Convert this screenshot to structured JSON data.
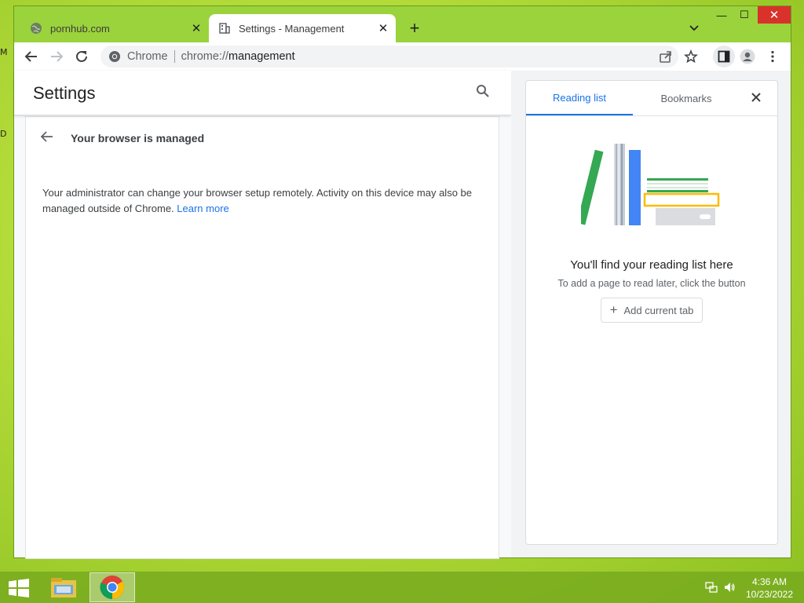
{
  "desktop": {
    "edge_labels": [
      "M",
      "D"
    ]
  },
  "browser": {
    "tabs": [
      {
        "title": "pornhub.com",
        "active": false,
        "favicon": "globe-icon"
      },
      {
        "title": "Settings - Management",
        "active": true,
        "favicon": "building-icon"
      }
    ],
    "new_tab_label": "+",
    "window_controls": {
      "minimize": "—",
      "maximize": "☐",
      "close": "✕"
    },
    "omnibox": {
      "chip": "Chrome",
      "url_prefix": "chrome://",
      "url_host": "management"
    }
  },
  "settings": {
    "title": "Settings",
    "subpage_title": "Your browser is managed",
    "management_text": "Your administrator can change your browser setup remotely. Activity on this device may also be managed outside of Chrome.",
    "learn_more": "Learn more"
  },
  "side_panel": {
    "tabs": [
      "Reading list",
      "Bookmarks"
    ],
    "active_tab": "Reading list",
    "empty_title": "You'll find your reading list here",
    "empty_subtitle": "To add a page to read later, click the button",
    "add_button": "Add current tab"
  },
  "taskbar": {
    "time": "4:36 AM",
    "date": "10/23/2022"
  },
  "colors": {
    "accent": "#1a73e8",
    "frame": "#9bd33c",
    "close_button": "#d9322b",
    "book_green": "#34a853",
    "book_blue": "#4285f4",
    "book_yellow": "#fbbc04"
  }
}
